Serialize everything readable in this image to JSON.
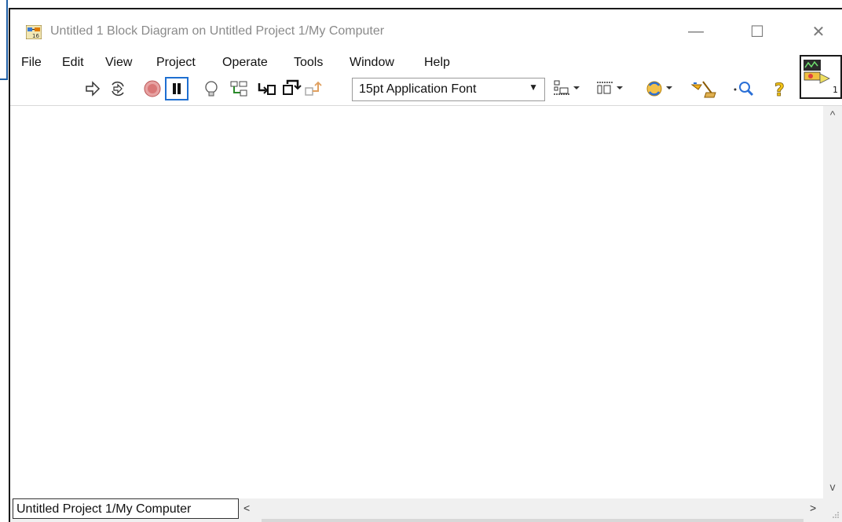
{
  "window": {
    "title": "Untitled 1 Block Diagram on Untitled Project 1/My Computer",
    "controls": {
      "minimize": "—",
      "maximize": "☐",
      "close": "✕"
    }
  },
  "menubar": {
    "items": [
      {
        "label": "File"
      },
      {
        "label": "Edit"
      },
      {
        "label": "View"
      },
      {
        "label": "Project"
      },
      {
        "label": "Operate"
      },
      {
        "label": "Tools"
      },
      {
        "label": "Window"
      },
      {
        "label": "Help"
      }
    ]
  },
  "toolbar": {
    "font_select": "15pt Application Font",
    "icons": [
      "run-arrow-icon",
      "run-continuously-icon",
      "abort-icon",
      "pause-icon",
      "highlight-execution-icon",
      "retain-wire-values-icon",
      "step-into-icon",
      "step-over-icon",
      "step-out-icon",
      "align-objects-icon",
      "distribute-objects-icon",
      "reorder-icon",
      "clean-up-diagram-icon",
      "search-icon",
      "context-help-icon"
    ]
  },
  "statusbar": {
    "project_label": "Untitled Project 1/My Computer",
    "scroll_left": "<",
    "scroll_right": ">"
  },
  "scrollbar": {
    "up": "^",
    "down": "v"
  },
  "colors": {
    "frame": "#1a1a1a",
    "accent_blue": "#1f5fa6",
    "title_text": "#8a8a8a",
    "pause_blue": "#1f6fd1"
  }
}
